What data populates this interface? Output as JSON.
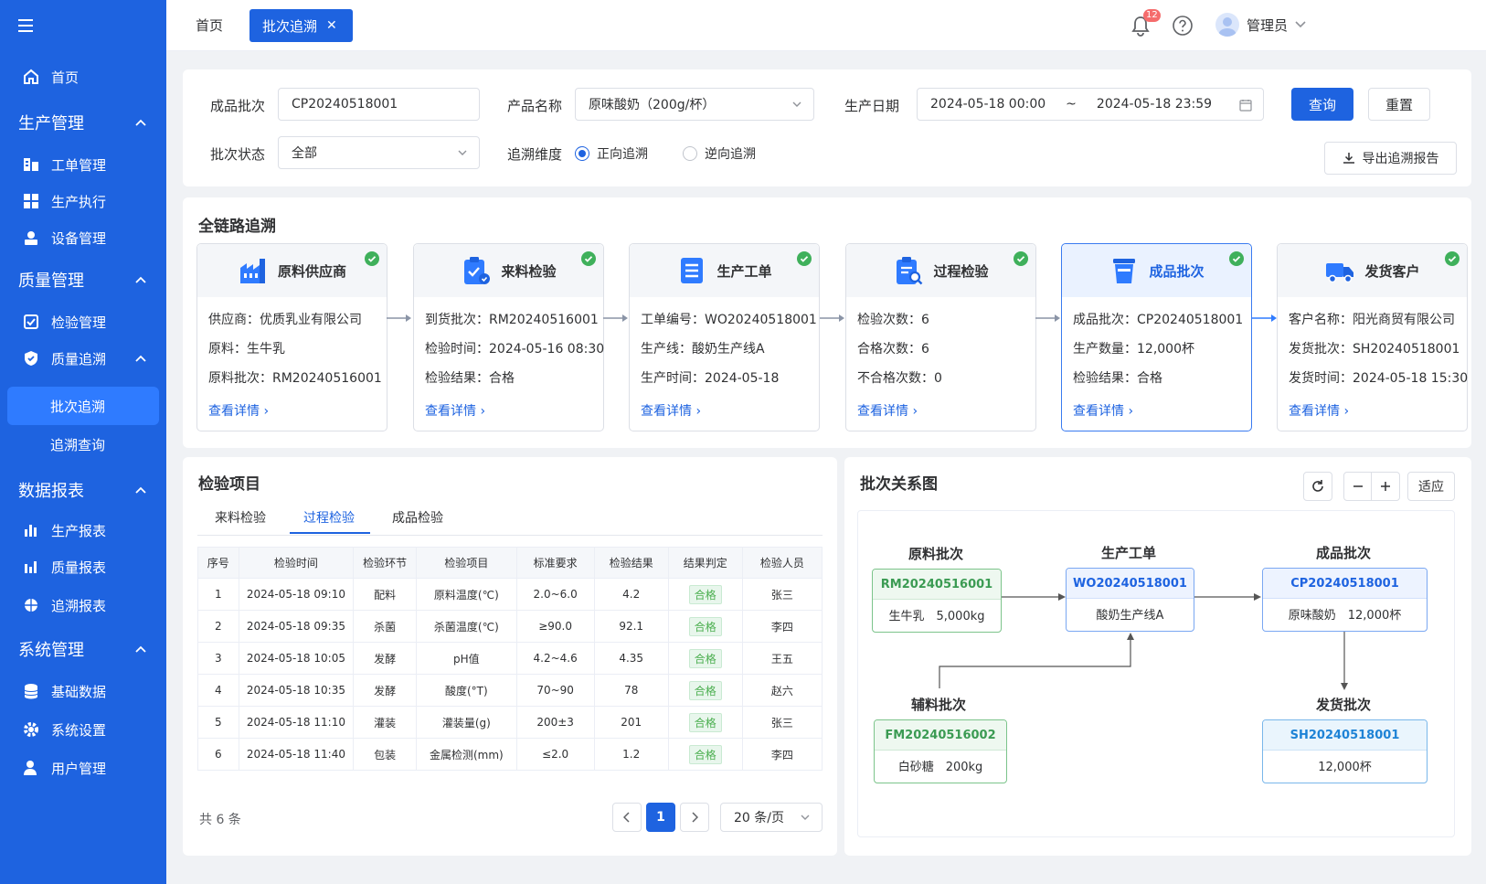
{
  "sidebar": {
    "home": "首页",
    "groups": [
      {
        "label": "生产管理",
        "items": [
          "工单管理",
          "生产执行",
          "设备管理"
        ]
      },
      {
        "label": "质量管理",
        "items": [
          "检验管理",
          "质量追溯"
        ],
        "subitems": [
          "批次追溯",
          "追溯查询"
        ]
      },
      {
        "label": "数据报表",
        "items": [
          "生产报表",
          "质量报表",
          "追溯报表"
        ]
      },
      {
        "label": "系统管理",
        "items": [
          "基础数据",
          "系统设置",
          "用户管理"
        ]
      }
    ]
  },
  "header": {
    "tab_home": "首页",
    "tab_active": "批次追溯",
    "notification_count": "12",
    "user_name": "管理员"
  },
  "filter": {
    "batch_label": "成品批次",
    "batch_value": "CP20240518001",
    "product_label": "产品名称",
    "product_value": "原味酸奶（200g/杯）",
    "date_label": "生产日期",
    "date_start": "2024-05-18 00:00",
    "date_sep": "~",
    "date_end": "2024-05-18 23:59",
    "query_btn": "查询",
    "reset_btn": "重置",
    "status_label": "批次状态",
    "status_value": "全部",
    "dim_label": "追溯维度",
    "dim_forward": "正向追溯",
    "dim_backward": "逆向追溯",
    "export_btn": "导出追溯报告"
  },
  "chain": {
    "title": "全链路追溯",
    "detail_link": "查看详情",
    "nodes": [
      {
        "title": "原料供应商",
        "rows": [
          "供应商：优质乳业有限公司",
          "原料：生牛乳",
          "原料批次：RM20240516001"
        ]
      },
      {
        "title": "来料检验",
        "rows": [
          "到货批次：RM20240516001",
          "检验时间：2024-05-16 08:30",
          "检验结果：合格"
        ]
      },
      {
        "title": "生产工单",
        "rows": [
          "工单编号：WO20240518001",
          "生产线：酸奶生产线A",
          "生产时间：2024-05-18"
        ]
      },
      {
        "title": "过程检验",
        "rows": [
          "检验次数：6",
          "合格次数：6",
          "不合格次数：0"
        ]
      },
      {
        "title": "成品批次",
        "rows": [
          "成品批次：CP20240518001",
          "生产数量：12,000杯",
          "检验结果：合格"
        ]
      },
      {
        "title": "发货客户",
        "rows": [
          "客户名称：阳光商贸有限公司",
          "发货批次：SH20240518001",
          "发货时间：2024-05-18 15:30"
        ]
      }
    ]
  },
  "inspection": {
    "title": "检验项目",
    "tabs": [
      "来料检验",
      "过程检验",
      "成品检验"
    ],
    "columns": [
      "序号",
      "检验时间",
      "检验环节",
      "检验项目",
      "标准要求",
      "检验结果",
      "结果判定",
      "检验人员"
    ],
    "rows": [
      [
        "1",
        "2024-05-18 09:10",
        "配料",
        "原料温度(℃)",
        "2.0~6.0",
        "4.2",
        "合格",
        "张三"
      ],
      [
        "2",
        "2024-05-18 09:35",
        "杀菌",
        "杀菌温度(℃)",
        "≥90.0",
        "92.1",
        "合格",
        "李四"
      ],
      [
        "3",
        "2024-05-18 10:05",
        "发酵",
        "pH值",
        "4.2~4.6",
        "4.35",
        "合格",
        "王五"
      ],
      [
        "4",
        "2024-05-18 10:35",
        "发酵",
        "酸度(°T)",
        "70~90",
        "78",
        "合格",
        "赵六"
      ],
      [
        "5",
        "2024-05-18 11:10",
        "灌装",
        "灌装量(g)",
        "200±3",
        "201",
        "合格",
        "张三"
      ],
      [
        "6",
        "2024-05-18 11:40",
        "包装",
        "金属检测(mm)",
        "≤2.0",
        "1.2",
        "合格",
        "李四"
      ]
    ],
    "total": "共 6 条",
    "page": "1",
    "page_size": "20 条/页"
  },
  "relation": {
    "title": "批次关系图",
    "fit_btn": "适应",
    "raw_label": "原料批次",
    "raw_batch": "RM20240516001",
    "raw_desc": "生牛乳　5,000kg",
    "wo_label": "生产工单",
    "wo_batch": "WO20240518001",
    "wo_desc": "酸奶生产线A",
    "fp_label": "成品批次",
    "fp_batch": "CP20240518001",
    "fp_desc": "原味酸奶　12,000杯",
    "aux_label": "辅料批次",
    "aux_batch": "FM20240516002",
    "aux_desc": "白砂糖　200kg",
    "ship_label": "发货批次",
    "ship_batch": "SH20240518001",
    "ship_desc": "12,000杯"
  }
}
